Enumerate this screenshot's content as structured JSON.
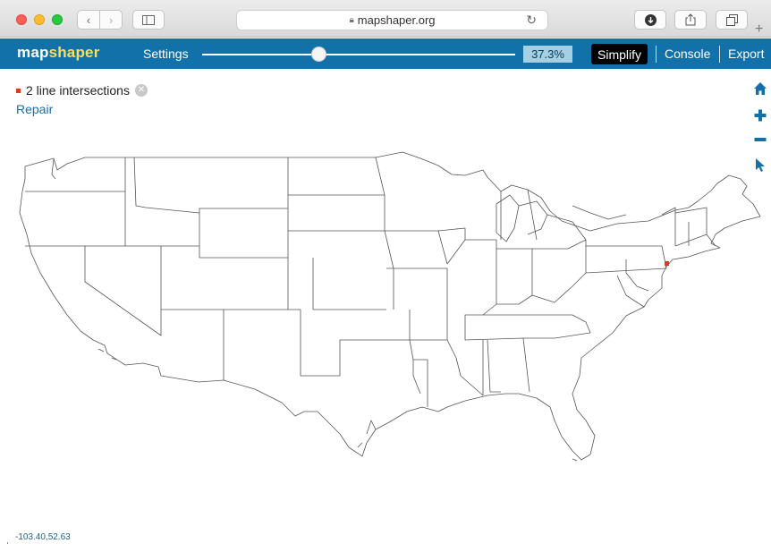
{
  "browser": {
    "url": "mapshaper.org",
    "icons": [
      "back-icon",
      "forward-icon",
      "sidebar-icon",
      "lock-icon",
      "reload-icon",
      "download-icon",
      "share-icon",
      "tabs-icon",
      "new-tab-icon"
    ]
  },
  "header": {
    "logo_map": "map",
    "logo_shaper": "shaper",
    "settings_label": "Settings",
    "simplify_percent": "37.3%",
    "simplify_fraction": 0.373,
    "menu": {
      "simplify": "Simplify",
      "console": "Console",
      "export": "Export"
    },
    "active_menu": "Simplify"
  },
  "intersections": {
    "label": "2 line intersections",
    "repair_label": "Repair"
  },
  "tools": [
    "home-icon",
    "zoom-in-icon",
    "zoom-out-icon",
    "pointer-icon"
  ],
  "coordinates": "-103.40,52.63",
  "colors": {
    "header": "#1271a8",
    "logo_accent": "#f7e15b",
    "intersection": "#e03a1e",
    "map_stroke": "#555555"
  }
}
